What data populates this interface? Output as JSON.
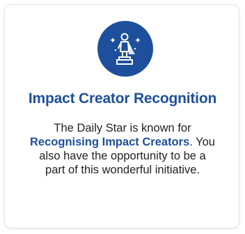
{
  "card": {
    "icon": "award-statue-icon",
    "title": "Impact Creator Recognition",
    "description": {
      "line1": "The Daily Star is known for",
      "highlight": "Recognising Impact Creators",
      "line2_suffix": ". You",
      "line3": "also have the opportunity to be a",
      "line4": "part of this wonderful initiative."
    }
  },
  "colors": {
    "accent": "#1d4f9c",
    "text": "#222222",
    "background": "#ffffff"
  }
}
